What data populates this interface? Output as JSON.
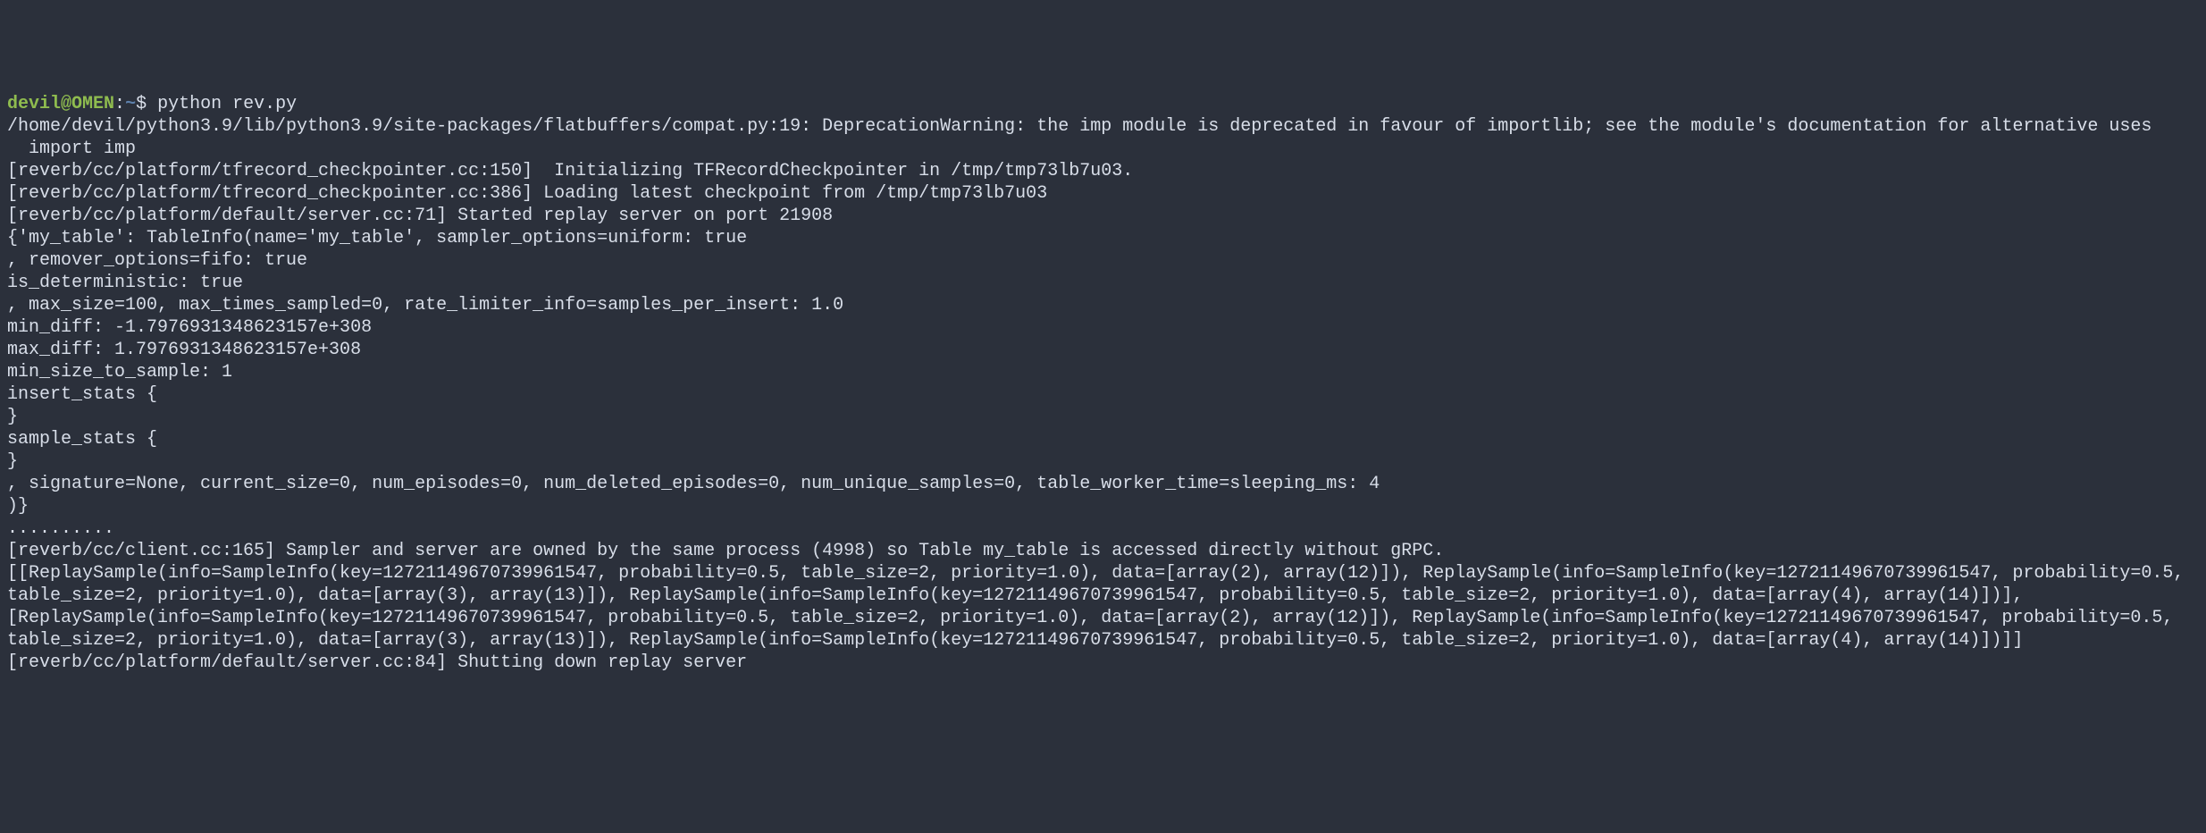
{
  "prompt": {
    "user": "devil",
    "at": "@",
    "host": "OMEN",
    "colon": ":",
    "path": "~",
    "dollar": "$",
    "command": "python rev.py"
  },
  "output": {
    "lines": [
      "/home/devil/python3.9/lib/python3.9/site-packages/flatbuffers/compat.py:19: DeprecationWarning: the imp module is deprecated in favour of importlib; see the module's documentation for alternative uses",
      "  import imp",
      "[reverb/cc/platform/tfrecord_checkpointer.cc:150]  Initializing TFRecordCheckpointer in /tmp/tmp73lb7u03.",
      "[reverb/cc/platform/tfrecord_checkpointer.cc:386] Loading latest checkpoint from /tmp/tmp73lb7u03",
      "[reverb/cc/platform/default/server.cc:71] Started replay server on port 21908",
      "{'my_table': TableInfo(name='my_table', sampler_options=uniform: true",
      ", remover_options=fifo: true",
      "is_deterministic: true",
      ", max_size=100, max_times_sampled=0, rate_limiter_info=samples_per_insert: 1.0",
      "min_diff: -1.7976931348623157e+308",
      "max_diff: 1.7976931348623157e+308",
      "min_size_to_sample: 1",
      "insert_stats {",
      "}",
      "sample_stats {",
      "}",
      ", signature=None, current_size=0, num_episodes=0, num_deleted_episodes=0, num_unique_samples=0, table_worker_time=sleeping_ms: 4",
      ")}",
      "..........",
      "[reverb/cc/client.cc:165] Sampler and server are owned by the same process (4998) so Table my_table is accessed directly without gRPC.",
      "[[ReplaySample(info=SampleInfo(key=12721149670739961547, probability=0.5, table_size=2, priority=1.0), data=[array(2), array(12)]), ReplaySample(info=SampleInfo(key=12721149670739961547, probability=0.5, table_size=2, priority=1.0), data=[array(3), array(13)]), ReplaySample(info=SampleInfo(key=12721149670739961547, probability=0.5, table_size=2, priority=1.0), data=[array(4), array(14)])], [ReplaySample(info=SampleInfo(key=12721149670739961547, probability=0.5, table_size=2, priority=1.0), data=[array(2), array(12)]), ReplaySample(info=SampleInfo(key=12721149670739961547, probability=0.5, table_size=2, priority=1.0), data=[array(3), array(13)]), ReplaySample(info=SampleInfo(key=12721149670739961547, probability=0.5, table_size=2, priority=1.0), data=[array(4), array(14)])]]",
      "[reverb/cc/platform/default/server.cc:84] Shutting down replay server"
    ]
  }
}
